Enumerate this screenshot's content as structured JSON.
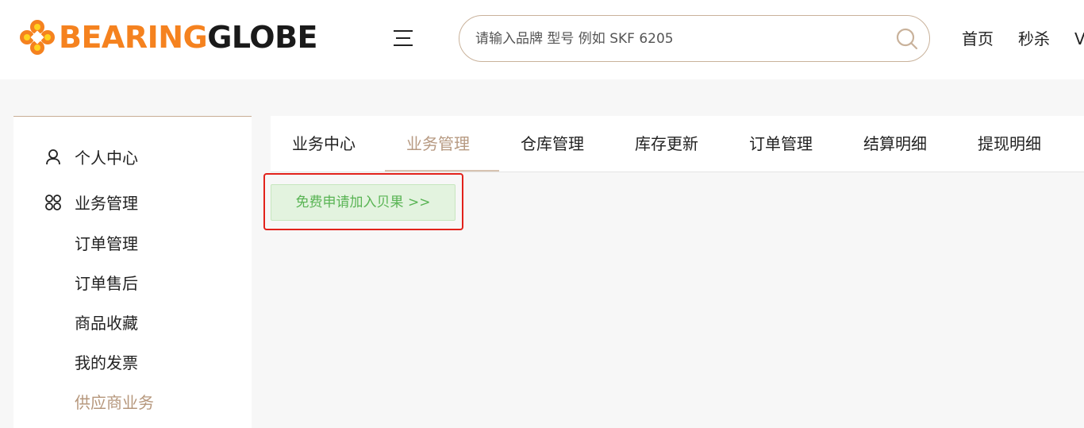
{
  "header": {
    "logo": {
      "part1": "BEARING",
      "part2": "GLOBE"
    },
    "search": {
      "placeholder": "请输入品牌 型号 例如 SKF 6205",
      "value": ""
    },
    "nav": [
      "首页",
      "秒杀",
      "V"
    ]
  },
  "sidebar": {
    "items": [
      {
        "label": "个人中心",
        "icon": "user-icon"
      },
      {
        "label": "业务管理",
        "icon": "grid-icon"
      }
    ],
    "sub_items": [
      {
        "label": "订单管理",
        "active": false
      },
      {
        "label": "订单售后",
        "active": false
      },
      {
        "label": "商品收藏",
        "active": false
      },
      {
        "label": "我的发票",
        "active": false
      },
      {
        "label": "供应商业务",
        "active": true
      }
    ]
  },
  "tabs": {
    "items": [
      "业务中心",
      "业务管理",
      "仓库管理",
      "库存更新",
      "订单管理",
      "结算明细",
      "提现明细"
    ],
    "active_index": 1
  },
  "main": {
    "apply_button": "免费申请加入贝果 >>"
  },
  "colors": {
    "brand_orange": "#f5821f",
    "accent_tan": "#b6977c",
    "highlight_red": "#e2221b",
    "button_green_text": "#59b454",
    "button_green_bg": "#e3f3df"
  }
}
